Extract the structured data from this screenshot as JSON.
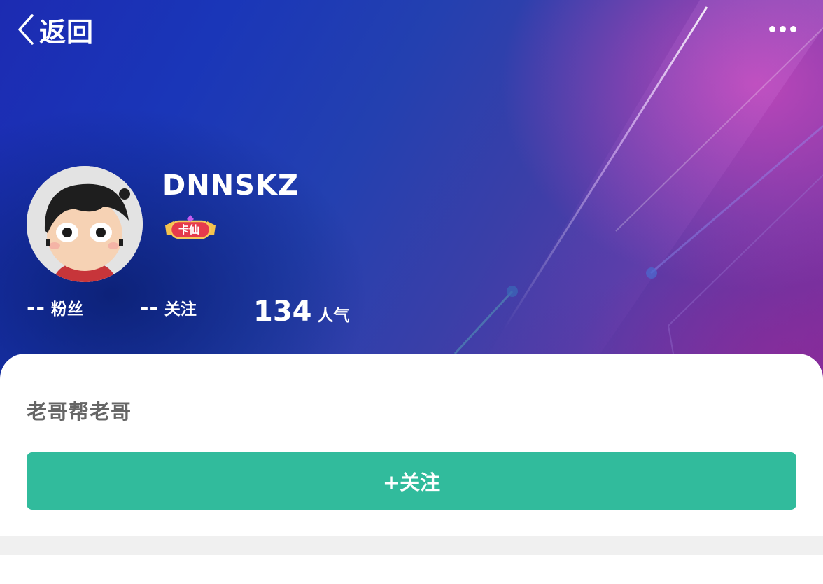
{
  "header": {
    "back_label": "返回",
    "back_icon": "chevron-left-icon",
    "more_icon": "more-horizontal-icon"
  },
  "profile": {
    "username": "DNNSKZ",
    "badge_label": "卡仙",
    "bio": "老哥帮老哥"
  },
  "stats": [
    {
      "value": "--",
      "label": "粉丝"
    },
    {
      "value": "--",
      "label": "关注"
    },
    {
      "value": "134",
      "label": "人气"
    }
  ],
  "actions": {
    "follow_label": "+关注"
  },
  "colors": {
    "accent": "#31bb9c",
    "hero_blue": "#1c2bb2",
    "hero_purple": "#7b2f9e",
    "bio_text": "#666666",
    "band": "#f0f0f0"
  }
}
